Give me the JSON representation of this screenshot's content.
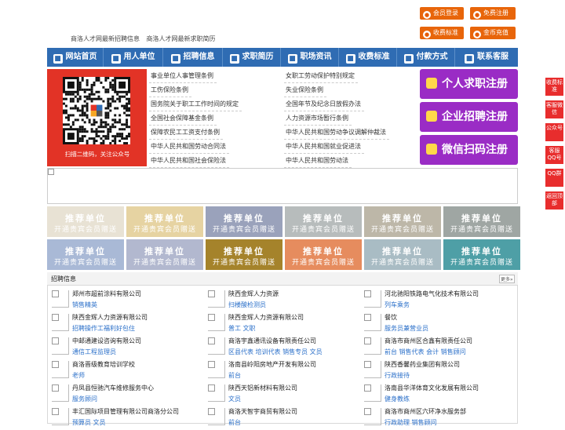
{
  "top_buttons": [
    {
      "label": "会员登录",
      "icon": "user-icon",
      "color": "#e8650a"
    },
    {
      "label": "免费注册",
      "icon": "register-icon",
      "color": "#e8650a"
    },
    {
      "label": "收费标准",
      "icon": "price-icon",
      "color": "#e8650a"
    },
    {
      "label": "金币充值",
      "icon": "coin-icon",
      "color": "#e8650a"
    }
  ],
  "seo_text": "商洛人才网最新招聘信息 商洛人才网最新求职简历",
  "nav": [
    {
      "label": "网站首页",
      "icon": "home-icon"
    },
    {
      "label": "用人单位",
      "icon": "building-icon"
    },
    {
      "label": "招聘信息",
      "icon": "megaphone-icon"
    },
    {
      "label": "求职简历",
      "icon": "resume-icon"
    },
    {
      "label": "职场资讯",
      "icon": "news-icon"
    },
    {
      "label": "收费标准",
      "icon": "price-icon"
    },
    {
      "label": "付款方式",
      "icon": "payment-icon"
    },
    {
      "label": "联系客服",
      "icon": "service-icon"
    }
  ],
  "qr_caption": "扫描二维码，关注公众号",
  "links_left": [
    "事业单位人事管理条例",
    "工伤保险条例",
    "国务院关于职工工作时间的规定",
    "全国社会保障基金条例",
    "保障农民工工资支付条例",
    "中华人民共和国劳动合同法",
    "中华人民共和国社会保险法"
  ],
  "links_right": [
    "女职工劳动保护特别规定",
    "失业保险条例",
    "全国年节及纪念日放假办法",
    "人力资源市场暂行条例",
    "中华人民共和国劳动争议调解仲裁法",
    "中华人民共和国就业促进法",
    "中华人民共和国劳动法"
  ],
  "big_buttons": [
    {
      "label": "个人求职注册",
      "icon": "person-icon"
    },
    {
      "label": "企业招聘注册",
      "icon": "company-icon"
    },
    {
      "label": "微信扫码注册",
      "icon": "wechat-icon"
    }
  ],
  "ad_title": "推荐单位",
  "ad_sub": "开通贵宾会员赠送",
  "ad_colors": [
    "#e8e2d4",
    "#e6d3a2",
    "#9aa2bb",
    "#b7bcbc",
    "#bdb7a8",
    "#9fa6a3",
    "#a9b9d6",
    "#b2b8cf",
    "#a5832b",
    "#e68c5e",
    "#a9bcc4",
    "#4e9fa6"
  ],
  "job_section_title": "招聘信息",
  "more_label": "更多»",
  "jobs": [
    [
      {
        "company": "郑州市超前涂料有限公司",
        "positions": "销售精英"
      },
      {
        "company": "陕西金辉人力资源有限公司",
        "positions": "招聘操作工福利好包住"
      },
      {
        "company": "中邮通建设咨询有限公司",
        "positions": "通信工程监理员"
      },
      {
        "company": "商洛晋级教育培训学校",
        "positions": "老师"
      },
      {
        "company": "丹凤县恒驰汽车维修服务中心",
        "positions": "服务顾问"
      },
      {
        "company": "丰汇国际项目管理有限公司商洛分公司",
        "positions": "预算员 文员"
      }
    ],
    [
      {
        "company": "陕西金辉人力资源",
        "positions": "扫楼酸检测员"
      },
      {
        "company": "陕西金辉人力资源有限公司",
        "positions": "普工 文职"
      },
      {
        "company": "商洛宇鑫通讯设备有限责任公司",
        "positions": "区县代表 培训代表 销售专员 文员"
      },
      {
        "company": "洛南县岭阳房地产开发有限公司",
        "positions": "前台"
      },
      {
        "company": "陕西天铝新材料有限公司",
        "positions": "文员"
      },
      {
        "company": "商洛天智宇商贸有限公司",
        "positions": "前台"
      }
    ],
    [
      {
        "company": "河北驰阳铁路电气化技术有限公司",
        "positions": "列车乘务"
      },
      {
        "company": "餐饮",
        "positions": "服务员兼营业员"
      },
      {
        "company": "商洛市商州区合鑫有限责任公司",
        "positions": "前台 销售代表 会计 销售顾问"
      },
      {
        "company": "陕西香馨药业集团有限公司",
        "positions": "行政接待"
      },
      {
        "company": "洛南县华洋体育文化发展有限公司",
        "positions": "健身教练"
      },
      {
        "company": "商洛市商州区六环净水服务部",
        "positions": "行政助理 销售顾问"
      }
    ]
  ],
  "side_buttons": [
    "收费标准",
    "客服微信",
    "公众号",
    "客服QQ号",
    "QQ群",
    "返回顶部"
  ],
  "accent": "#2f6cb3"
}
